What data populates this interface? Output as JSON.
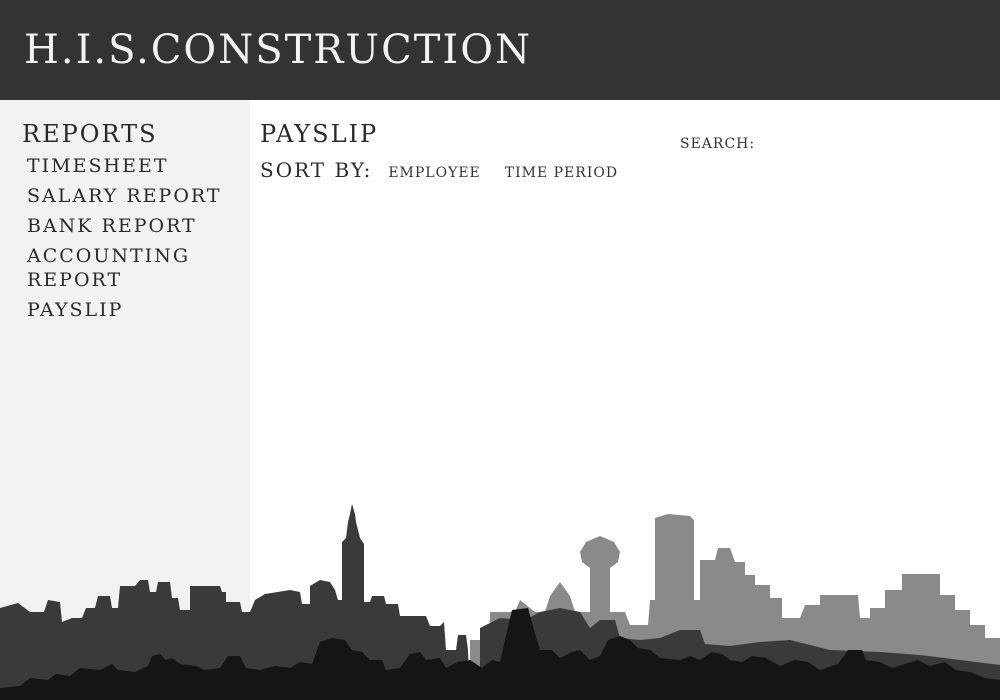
{
  "header": {
    "brand": "H.I.S.CONSTRUCTION"
  },
  "sidebar": {
    "title": "REPORTS",
    "items": [
      {
        "label": "TIMESHEET"
      },
      {
        "label": "SALARY REPORT"
      },
      {
        "label": "BANK REPORT"
      },
      {
        "label": "ACCOUNTING REPORT"
      },
      {
        "label": "PAYSLIP"
      }
    ]
  },
  "main": {
    "title": "PAYSLIP",
    "sort_label": "SORT BY:",
    "sort_options": [
      {
        "label": "EMPLOYEE"
      },
      {
        "label": "TIME PERIOD"
      }
    ],
    "search_label": "SEARCH:",
    "search_value": ""
  },
  "colors": {
    "header_bg": "#333333",
    "sidebar_bg": "#f2f2f2",
    "skyline_back": "#8a8a8a",
    "skyline_mid": "#3a3a3a",
    "skyline_front": "#151515"
  }
}
